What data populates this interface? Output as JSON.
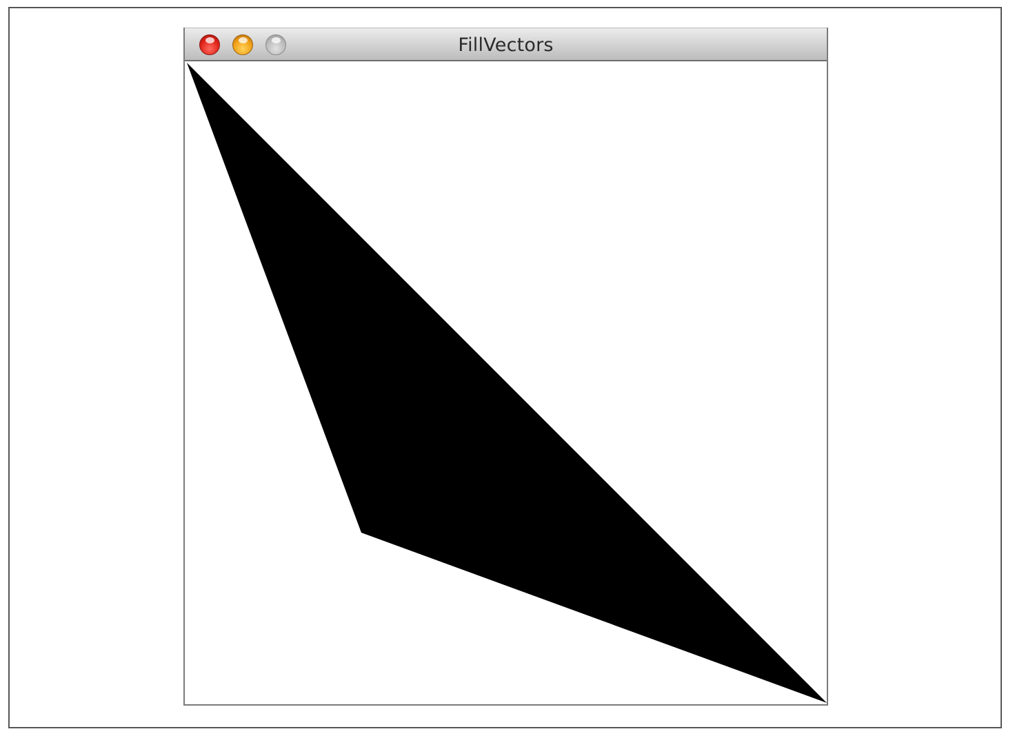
{
  "window": {
    "title": "FillVectors"
  },
  "controls": {
    "close_icon": "close-icon",
    "minimize_icon": "minimize-icon",
    "zoom_icon": "zoom-icon"
  },
  "canvas": {
    "background_color": "#ffffff",
    "shape_fill_color": "#000000"
  }
}
